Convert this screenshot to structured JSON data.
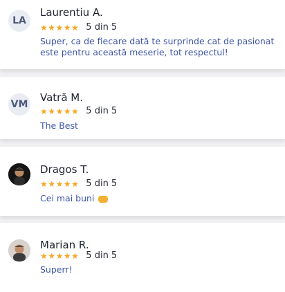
{
  "reviews": [
    {
      "initials": "LA",
      "name": "Laurentiu A.",
      "stars": "★★★★★",
      "rating": "5 din 5",
      "text": "Super, ca de fiecare dată te surprinde cat de pasionat este pentru această meserie, tot respectul!"
    },
    {
      "initials": "VM",
      "name": "Vatră M.",
      "stars": "★★★★★",
      "rating": "5 din 5",
      "text": "The Best"
    },
    {
      "initials": "",
      "name": "Dragos T.",
      "stars": "★★★★★",
      "rating": "5 din 5",
      "text": "Cei mai buni"
    },
    {
      "initials": "",
      "name": "Marian R.",
      "stars": "★★★★★",
      "rating": "5 din 5",
      "text": "Superr!"
    }
  ],
  "colors": {
    "star": "#f5a623",
    "review_text": "#3d55a8",
    "avatar_bg": "#e9ecf2",
    "avatar_text": "#4d5a7a"
  },
  "icons": {
    "star": "star-icon",
    "emoji": "handshake-emoji-icon"
  }
}
